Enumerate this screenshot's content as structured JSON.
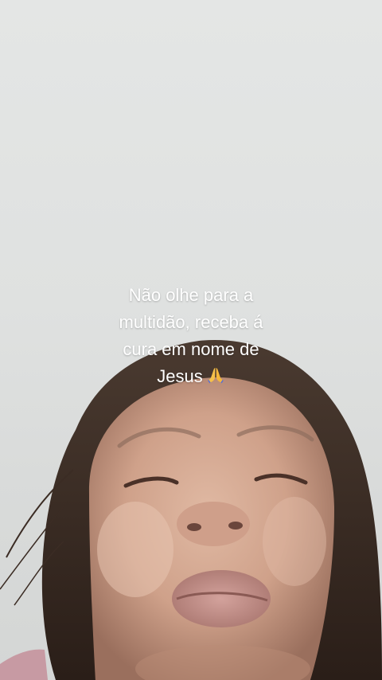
{
  "caption": {
    "lines": [
      "Não  olhe para a",
      "multidão, receba á",
      "cura em nome de",
      "Jesus"
    ],
    "emoji": "folded-hands"
  },
  "colors": {
    "wall": "#e1e3e2",
    "skin": "#c69b85",
    "hair": "#3a2a22",
    "lips": "#b98a84",
    "caption_text": "#ffffff"
  }
}
